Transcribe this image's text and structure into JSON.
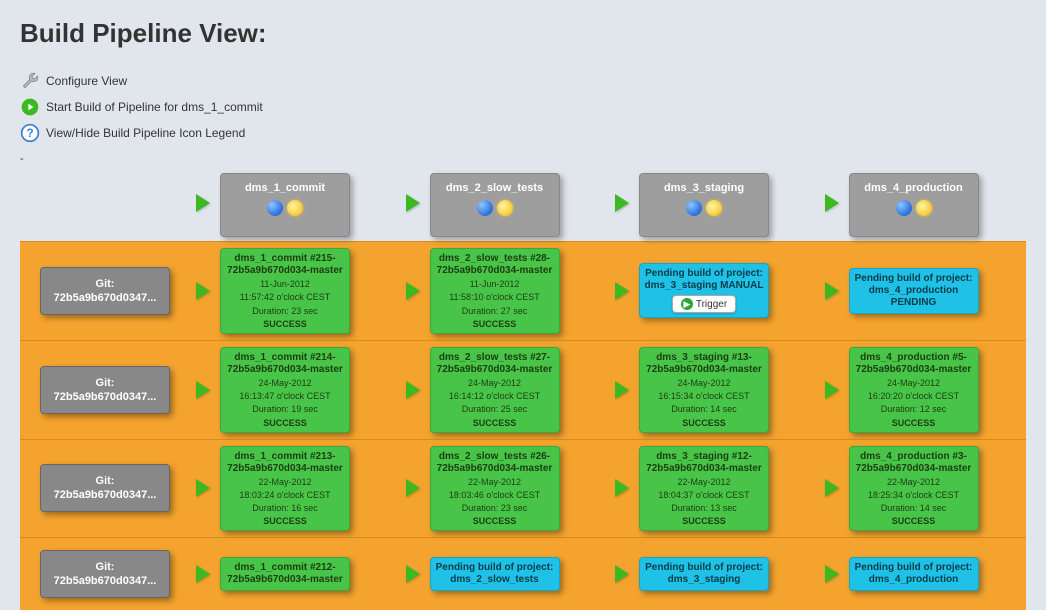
{
  "title": "Build Pipeline View:",
  "actions": {
    "configure": "Configure View",
    "start": "Start Build of Pipeline for dms_1_commit",
    "legend": "View/Hide Build Pipeline Icon Legend"
  },
  "stages": [
    "dms_1_commit",
    "dms_2_slow_tests",
    "dms_3_staging",
    "dms_4_production"
  ],
  "trigger_label": "Trigger",
  "rows": [
    {
      "git_label": "Git:",
      "git_sha": "72b5a9b670d0347...",
      "cells": [
        {
          "state": "success",
          "name": "dms_1_commit #215-72b5a9b670d034-master",
          "date": "11-Jun-2012",
          "time": "11:57:42 o'clock CEST",
          "dur": "Duration: 23 sec",
          "status": "SUCCESS"
        },
        {
          "state": "success",
          "name": "dms_2_slow_tests #28-72b5a9b670d034-master",
          "date": "11-Jun-2012",
          "time": "11:58:10 o'clock CEST",
          "dur": "Duration: 27 sec",
          "status": "SUCCESS"
        },
        {
          "state": "manual",
          "name": "Pending build of project: dms_3_staging MANUAL",
          "trigger": true
        },
        {
          "state": "pending",
          "name": "Pending build of project: dms_4_production PENDING"
        }
      ]
    },
    {
      "git_label": "Git:",
      "git_sha": "72b5a9b670d0347...",
      "cells": [
        {
          "state": "success",
          "name": "dms_1_commit #214-72b5a9b670d034-master",
          "date": "24-May-2012",
          "time": "16:13:47 o'clock CEST",
          "dur": "Duration: 19 sec",
          "status": "SUCCESS"
        },
        {
          "state": "success",
          "name": "dms_2_slow_tests #27-72b5a9b670d034-master",
          "date": "24-May-2012",
          "time": "16:14:12 o'clock CEST",
          "dur": "Duration: 25 sec",
          "status": "SUCCESS"
        },
        {
          "state": "success",
          "name": "dms_3_staging #13-72b5a9b670d034-master",
          "date": "24-May-2012",
          "time": "16:15:34 o'clock CEST",
          "dur": "Duration: 14 sec",
          "status": "SUCCESS"
        },
        {
          "state": "success",
          "name": "dms_4_production #5-72b5a9b670d034-master",
          "date": "24-May-2012",
          "time": "16:20:20 o'clock CEST",
          "dur": "Duration: 12 sec",
          "status": "SUCCESS"
        }
      ]
    },
    {
      "git_label": "Git:",
      "git_sha": "72b5a9b670d0347...",
      "cells": [
        {
          "state": "success",
          "name": "dms_1_commit #213-72b5a9b670d034-master",
          "date": "22-May-2012",
          "time": "18:03:24 o'clock CEST",
          "dur": "Duration: 16 sec",
          "status": "SUCCESS"
        },
        {
          "state": "success",
          "name": "dms_2_slow_tests #26-72b5a9b670d034-master",
          "date": "22-May-2012",
          "time": "18:03:46 o'clock CEST",
          "dur": "Duration: 23 sec",
          "status": "SUCCESS"
        },
        {
          "state": "success",
          "name": "dms_3_staging #12-72b5a9b670d034-master",
          "date": "22-May-2012",
          "time": "18:04:37 o'clock CEST",
          "dur": "Duration: 13 sec",
          "status": "SUCCESS"
        },
        {
          "state": "success",
          "name": "dms_4_production #3-72b5a9b670d034-master",
          "date": "22-May-2012",
          "time": "18:25:34 o'clock CEST",
          "dur": "Duration: 14 sec",
          "status": "SUCCESS"
        }
      ]
    },
    {
      "git_label": "Git:",
      "git_sha": "72b5a9b670d0347...",
      "cells": [
        {
          "state": "success",
          "name": "dms_1_commit #212-72b5a9b670d034-master"
        },
        {
          "state": "pending",
          "name": "Pending build of project: dms_2_slow_tests"
        },
        {
          "state": "pending",
          "name": "Pending build of project: dms_3_staging"
        },
        {
          "state": "pending",
          "name": "Pending build of project: dms_4_production"
        }
      ]
    }
  ]
}
